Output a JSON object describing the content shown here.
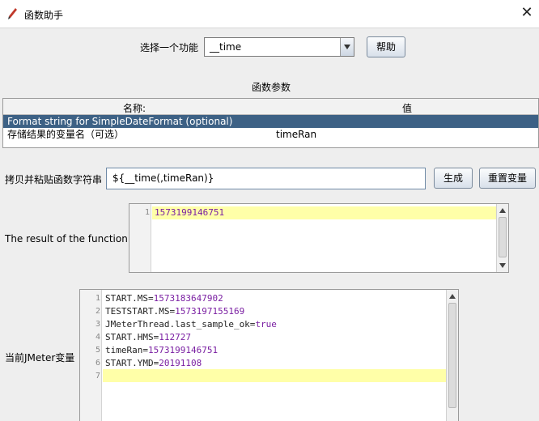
{
  "window": {
    "title": "函数助手"
  },
  "function_picker": {
    "label": "选择一个功能",
    "selected": "__time",
    "help_label": "帮助"
  },
  "params": {
    "section_title": "函数参数",
    "col_name": "名称:",
    "col_value": "值",
    "rows": [
      {
        "name": "Format string for SimpleDateFormat (optional)",
        "value": ""
      },
      {
        "name": "存储结果的变量名（可选）",
        "value": "timeRan"
      }
    ]
  },
  "paste": {
    "label": "拷贝并粘贴函数字符串",
    "value": "${__time(,timeRan)}",
    "generate_label": "生成",
    "reset_label": "重置变量"
  },
  "result": {
    "label": "The result of the function is",
    "lines": [
      {
        "num": "1",
        "key": "",
        "val": "1573199146751"
      }
    ]
  },
  "vars": {
    "label": "当前JMeter变量",
    "lines": [
      {
        "num": "1",
        "key": "START.MS=",
        "val": "1573183647902"
      },
      {
        "num": "2",
        "key": "TESTSTART.MS=",
        "val": "1573197155169"
      },
      {
        "num": "3",
        "key": "JMeterThread.last_sample_ok=",
        "val": "true"
      },
      {
        "num": "4",
        "key": "START.HMS=",
        "val": "112727"
      },
      {
        "num": "5",
        "key": "timeRan=",
        "val": "1573199146751"
      },
      {
        "num": "6",
        "key": "START.YMD=",
        "val": "20191108"
      },
      {
        "num": "7",
        "key": "",
        "val": ""
      }
    ]
  },
  "colors": {
    "selection": "#3d6185",
    "current_line": "#ffffa8",
    "value_text": "#7a1fa2"
  }
}
